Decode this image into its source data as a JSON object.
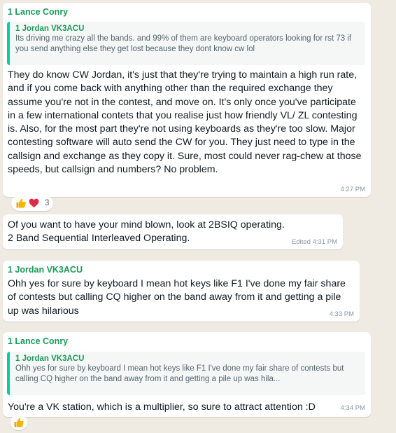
{
  "messages": [
    {
      "sender": "1 Lance Conry",
      "quote": {
        "name": "1 Jordan VK3ACU",
        "text": "Its driving me crazy all the bands. and 99% of them are keyboard operators looking for rst 73 if you send anything else they get lost because they dont know cw lol"
      },
      "text": "They do know CW Jordan, it's just that they're trying to maintain a high run rate, and if you come back with anything other than the required exchange they assume you're not in the contest, and move on.  It's only once you've participate in a few international contets that you realise just how friendly VL/ ZL contesting is. Also, for the most part they're not using keyboards as they're too slow.  Major contesting software will auto send the CW for you. They just need to type in the callsign and exchange as they copy it. Sure, most could never rag-chew at those speeds, but callsign and numbers?  No problem.",
      "time": "4:27 PM",
      "reactions": {
        "icons": [
          "thumbs-up",
          "heart"
        ],
        "count": "3"
      }
    },
    {
      "text": "Of you want to have your mind blown, look at 2BSIQ operating. 2 Band Sequential Interleaved Operating.",
      "time": "Edited 4:31 PM"
    },
    {
      "sender": "1 Jordan VK3ACU",
      "text": "Ohh yes for sure by keyboard I mean hot keys like F1 I've done my fair share of contests but calling CQ higher on the band away from it and getting a pile up was hilarious",
      "time": "4:33 PM"
    },
    {
      "sender": "1 Lance Conry",
      "quote": {
        "name": "1 Jordan VK3ACU",
        "text": "Ohh yes for sure by keyboard I mean hot keys like F1 I've done my fair share of contests but calling CQ higher on the band away from it and getting a pile up was hila..."
      },
      "text": "You're a VK station, which is a multiplier, so sure to attract attention :D",
      "time": "4:34 PM",
      "reactions": {
        "icons": [
          "thumbs-up"
        ]
      }
    }
  ],
  "colors": {
    "background": "#efeae2",
    "bubble": "#ffffff",
    "sender_name": "#1b9a59",
    "quote_bar": "#06cf9c",
    "timestamp": "#8696a0"
  }
}
